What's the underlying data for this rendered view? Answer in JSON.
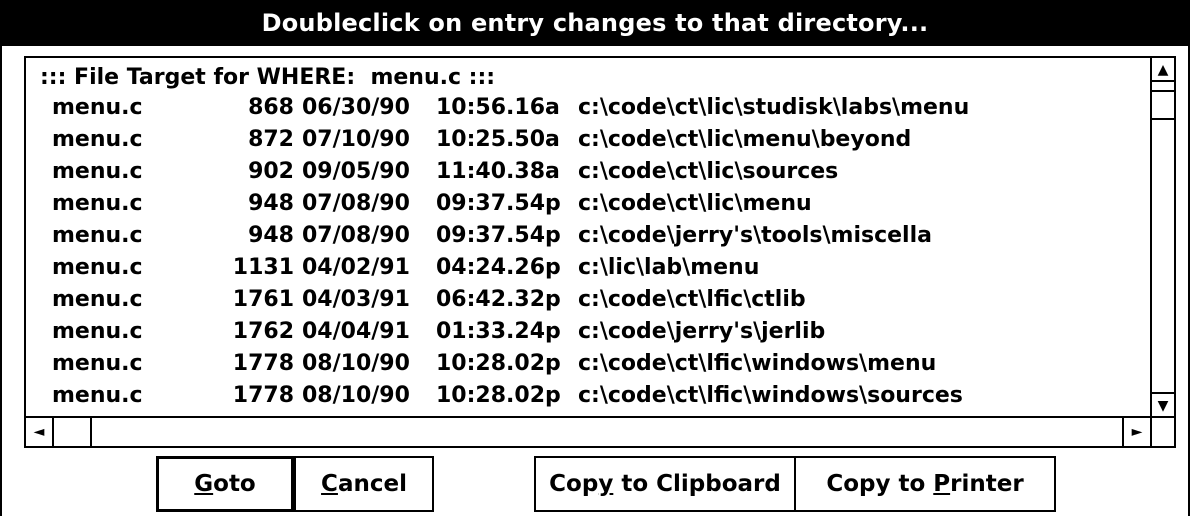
{
  "title": "Doubleclick on entry changes to that directory...",
  "list": {
    "header": "::: File Target for WHERE:  menu.c :::",
    "rows": [
      {
        "name": "menu.c",
        "size": "868",
        "date": "06/30/90",
        "time": "10:56.16a",
        "path": "c:\\code\\ct\\lic\\studisk\\labs\\menu"
      },
      {
        "name": "menu.c",
        "size": "872",
        "date": "07/10/90",
        "time": "10:25.50a",
        "path": "c:\\code\\ct\\lic\\menu\\beyond"
      },
      {
        "name": "menu.c",
        "size": "902",
        "date": "09/05/90",
        "time": "11:40.38a",
        "path": "c:\\code\\ct\\lic\\sources"
      },
      {
        "name": "menu.c",
        "size": "948",
        "date": "07/08/90",
        "time": "09:37.54p",
        "path": "c:\\code\\ct\\lic\\menu"
      },
      {
        "name": "menu.c",
        "size": "948",
        "date": "07/08/90",
        "time": "09:37.54p",
        "path": "c:\\code\\jerry's\\tools\\miscella"
      },
      {
        "name": "menu.c",
        "size": "1131",
        "date": "04/02/91",
        "time": "04:24.26p",
        "path": "c:\\lic\\lab\\menu"
      },
      {
        "name": "menu.c",
        "size": "1761",
        "date": "04/03/91",
        "time": "06:42.32p",
        "path": "c:\\code\\ct\\lfic\\ctlib"
      },
      {
        "name": "menu.c",
        "size": "1762",
        "date": "04/04/91",
        "time": "01:33.24p",
        "path": "c:\\code\\jerry's\\jerlib"
      },
      {
        "name": "menu.c",
        "size": "1778",
        "date": "08/10/90",
        "time": "10:28.02p",
        "path": "c:\\code\\ct\\lfic\\windows\\menu"
      },
      {
        "name": "menu.c",
        "size": "1778",
        "date": "08/10/90",
        "time": "10:28.02p",
        "path": "c:\\code\\ct\\lfic\\windows\\sources"
      }
    ]
  },
  "scroll": {
    "up": "▲",
    "down": "▼",
    "left": "◄",
    "right": "►"
  },
  "buttons": {
    "goto": {
      "mnemonic": "G",
      "rest": "oto"
    },
    "cancel": {
      "mnemonic": "C",
      "rest": "ancel"
    },
    "copy_clipboard": {
      "before": "Cop",
      "mnemonic": "y",
      "after": " to Clipboard"
    },
    "copy_printer": {
      "before": "Copy to ",
      "mnemonic": "P",
      "after": "rinter"
    }
  }
}
